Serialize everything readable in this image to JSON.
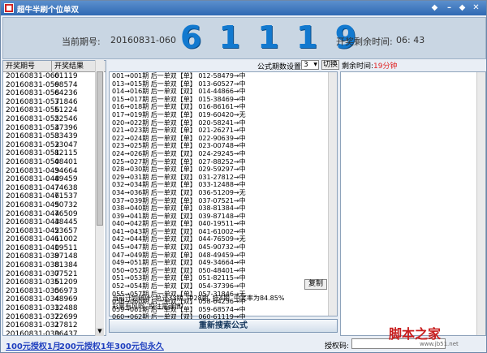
{
  "window": {
    "title": "超牛半刷个位单双"
  },
  "header": {
    "period_label": "当前期号:",
    "period_value": "20160831-060",
    "big_number": "6 1 1 1 9",
    "countdown_label": "开奖剩余时间:",
    "countdown_value": "06: 43"
  },
  "left_table": {
    "headers": [
      "开奖期号",
      "开奖结果"
    ],
    "rows": [
      [
        "20160831-060",
        "61119"
      ],
      [
        "20160831-059",
        "68574"
      ],
      [
        "20160831-058",
        "64236"
      ],
      [
        "20160831-057",
        "31846"
      ],
      [
        "20160831-056",
        "51224"
      ],
      [
        "20160831-055",
        "22546"
      ],
      [
        "20160831-054",
        "37396"
      ],
      [
        "20160831-053",
        "83439"
      ],
      [
        "20160831-052",
        "33047"
      ],
      [
        "20160831-051",
        "82115"
      ],
      [
        "20160831-050",
        "48401"
      ],
      [
        "20160831-049",
        "34664"
      ],
      [
        "20160831-048",
        "49459"
      ],
      [
        "20160831-047",
        "74638"
      ],
      [
        "20160831-046",
        "71537"
      ],
      [
        "20160831-045",
        "90732"
      ],
      [
        "20160831-044",
        "76509"
      ],
      [
        "20160831-043",
        "48445"
      ],
      [
        "20160831-042",
        "53657"
      ],
      [
        "20160831-041",
        "61002"
      ],
      [
        "20160831-040",
        "19511"
      ],
      [
        "20160831-039",
        "87148"
      ],
      [
        "20160831-038",
        "81384"
      ],
      [
        "20160831-037",
        "07521"
      ],
      [
        "20160831-036",
        "51209"
      ],
      [
        "20160831-035",
        "06973"
      ],
      [
        "20160831-034",
        "48969"
      ],
      [
        "20160831-033",
        "12488"
      ],
      [
        "20160831-032",
        "72699"
      ],
      [
        "20160831-031",
        "27812"
      ],
      [
        "20160831-030",
        "36437"
      ]
    ]
  },
  "formula": {
    "setting_label": "公式期数设置:",
    "setting_value": "3",
    "switch_label": "切换",
    "lines": [
      "001→001期 后一单双【单】 012-58479→中",
      "013→015期 后一单双【单】 013-60527→中",
      "014→016期 后一单双【双】 014-44866→中",
      "015→017期 后一单双【单】 015-38469→中",
      "016→018期 后一单双【双】 016-86161→中",
      "017→019期 后一单双【单】 019-60420→无",
      "020→022期 后一单双【单】 020-58241→中",
      "021→023期 后一单双【单】 021-26271→中",
      "022→024期 后一单双【单】 022-90639→中",
      "023→025期 后一单双【单】 023-00748→中",
      "024→026期 后一单双【双】 024-29245→中",
      "025→027期 后一单双【单】 027-88252→中",
      "028→030期 后一单双【单】 029-59297→中",
      "029→031期 后一单双【双】 031-27812→中",
      "032→034期 后一单双【单】 033-12488→中",
      "034→036期 后一单双【双】 036-51209→无",
      "037→039期 后一单双【单】 037-07521→中",
      "038→040期 后一单双【单】 038-81384→中",
      "039→041期 后一单双【双】 039-87148→中",
      "040→042期 后一单双【单】 040-19511→中",
      "041→043期 后一单双【双】 041-61002→中",
      "042→044期 后一单双【双】 044-76509→无",
      "045→047期 后一单双【双】 045-90732→中",
      "047→049期 后一单双【单】 048-49459→中",
      "049→051期 后一单双【双】 049-34664→中",
      "050→052期 后一单双【双】 050-48401→中",
      "051→053期 后一单双【单】 051-82115→中",
      "052→054期 后一单双【双】 054-37396→中",
      "055→057期 后一单双【单】 057-31846→无",
      "058→060期 后一单双【双】 058-64236→中",
      "059→061期 后一单双【单】 059-68574→中",
      "060→062期 后一单双【双】 060-61119→中",
      "061→063期 后一单双【双】 等开"
    ],
    "copy_label": "复制",
    "stats_line1": "当前计划统计: 总计33期, 中28期, 挂4期, 中奖率为84.85%",
    "stats_line2": "彩票有风险, 投注需谨慎!",
    "search_button": "重新搜索公式"
  },
  "right": {
    "countdown_label": "剩余时间:",
    "countdown_value": "19分钟"
  },
  "bottom": {
    "link1": "100元授权1月",
    "link2": "200元授权1年",
    "link3": "300元包永久",
    "auth_label": "授权码:"
  },
  "watermark": {
    "text": "脚本之家",
    "sub": "www.jb51.net"
  },
  "colors": {
    "accent": "#1279cf",
    "title_bar": "#2f69b3",
    "alert": "#e02020",
    "link": "#1f3fbf"
  }
}
